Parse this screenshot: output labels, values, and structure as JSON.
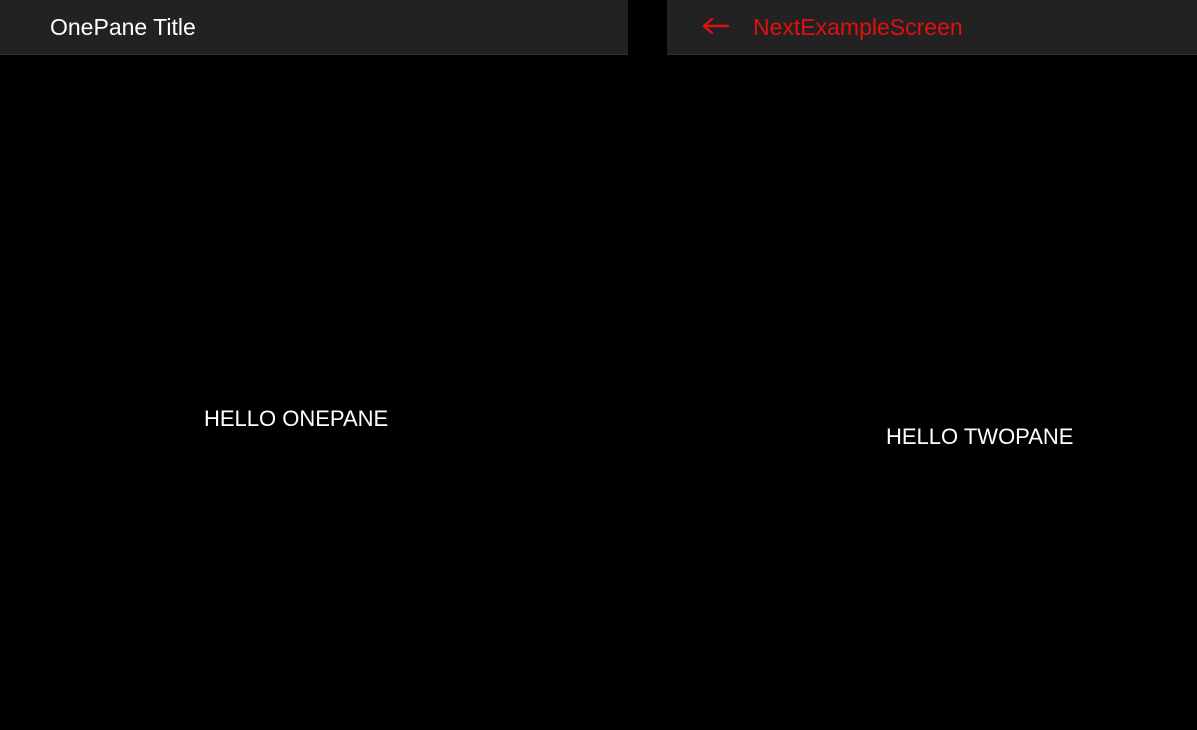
{
  "left_pane": {
    "title": "OnePane Title",
    "content_text": "HELLO ONEPANE"
  },
  "right_pane": {
    "back_icon": "arrow-left-icon",
    "title": "NextExampleScreen",
    "content_text": "HELLO TWOPANE"
  },
  "colors": {
    "background": "#000000",
    "appbar": "#222222",
    "title_text": "#ffffff",
    "accent_red": "#e01010"
  }
}
